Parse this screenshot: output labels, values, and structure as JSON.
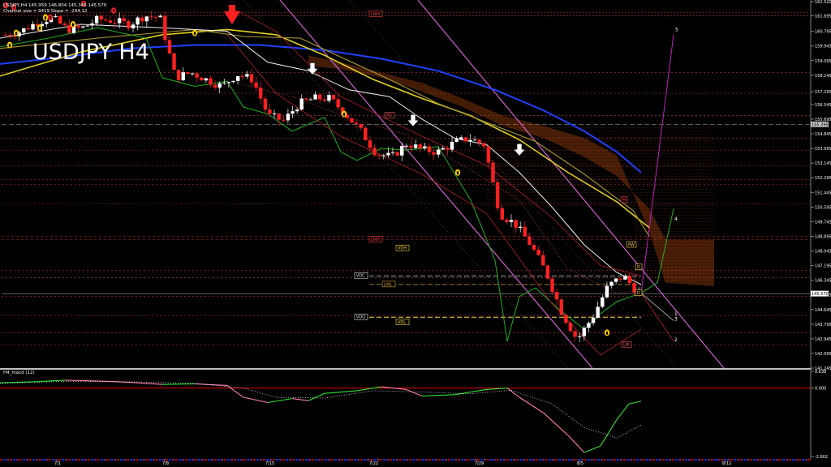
{
  "header": {
    "symbol_line": "USDJPY,H4 145.959 146.804 145.345 145.570",
    "channel_line": "Channel size = 9419 Slope = -244.12",
    "watermark": "USDJPY H4"
  },
  "indicator": {
    "label": "H4_macd (12)",
    "scale": [
      "0.638",
      "0.000",
      "-2.602"
    ]
  },
  "price_axis": [
    "162.520",
    "161.695",
    "160.795",
    "159.945",
    "159.095",
    "158.245",
    "157.295",
    "156.545",
    "155.695",
    "154.845",
    "153.995",
    "153.145",
    "152.295",
    "151.445",
    "150.595",
    "149.745",
    "148.895",
    "148.045",
    "147.195",
    "146.345",
    "145.495",
    "144.645",
    "143.795",
    "142.945",
    "142.095",
    "141.245"
  ],
  "current_price": "145.570",
  "level_price": "155.395",
  "time_axis": [
    "7/1",
    "7/8",
    "7/15",
    "7/22",
    "7/29",
    "8/5",
    "8/12"
  ],
  "level_labels": {
    "vdc": "VDC",
    "vdo": "VDO",
    "vdh": "VDH",
    "vdl": "VDL",
    "lwl": "LWL",
    "lwh": "LWH",
    "lmh": "LMH",
    "pd": "PD",
    "pw": "PW",
    "d": "D",
    "lw": "LW",
    "m": "M"
  },
  "wave_labels": [
    "5",
    "4",
    "3",
    "2",
    "1"
  ],
  "chart_data": {
    "type": "candlestick",
    "title": "USDJPY H4",
    "ylim": [
      141.245,
      162.52
    ],
    "x_ticks": [
      "7/1",
      "7/8",
      "7/15",
      "7/22",
      "7/29",
      "8/5",
      "8/12"
    ],
    "close_path": [
      160.6,
      160.8,
      161.3,
      161.6,
      160.9,
      161.0,
      161.5,
      161.4,
      161.2,
      161.7,
      161.6,
      158.1,
      158.4,
      158.0,
      157.6,
      158.3,
      158.0,
      155.9,
      155.6,
      156.6,
      156.9,
      156.9,
      156.0,
      155.0,
      153.7,
      153.5,
      154.3,
      153.9,
      153.8,
      154.3,
      154.6,
      154.2,
      150.2,
      149.6,
      148.4,
      146.8,
      144.5,
      142.9,
      144.2,
      146.0,
      146.6,
      145.57
    ],
    "indicator_series": {
      "name": "H4_macd (12)",
      "ylim": [
        -2.602,
        0.638
      ]
    }
  }
}
